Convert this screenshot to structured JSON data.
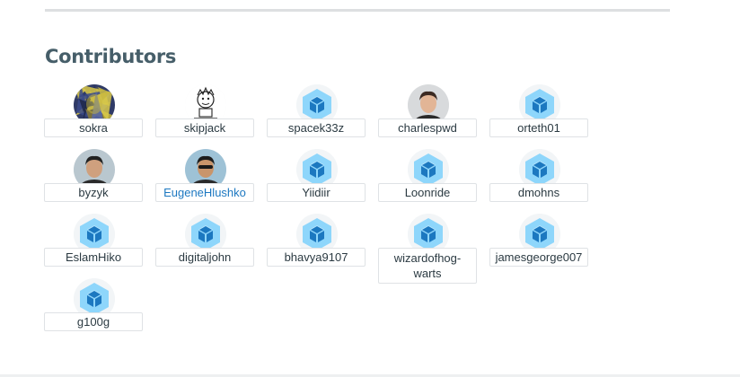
{
  "section": {
    "title": "Contributors"
  },
  "contributors": [
    {
      "name": "sokra",
      "avatar": "photo",
      "avatar_icon": "mosaic-portrait-avatar"
    },
    {
      "name": "skipjack",
      "avatar": "photo",
      "avatar_icon": "cartoon-character-avatar"
    },
    {
      "name": "spacek33z",
      "avatar": "default",
      "avatar_icon": "webpack-cube-icon"
    },
    {
      "name": "charlespwd",
      "avatar": "photo",
      "avatar_icon": "person-photo-avatar"
    },
    {
      "name": "orteth01",
      "avatar": "default",
      "avatar_icon": "webpack-cube-icon"
    },
    {
      "name": "byzyk",
      "avatar": "photo",
      "avatar_icon": "person-photo-avatar"
    },
    {
      "name": "EugeneHlushko",
      "avatar": "photo",
      "avatar_icon": "person-sunglasses-avatar",
      "highlighted": true
    },
    {
      "name": "Yiidiir",
      "avatar": "default",
      "avatar_icon": "webpack-cube-icon"
    },
    {
      "name": "Loonride",
      "avatar": "default",
      "avatar_icon": "webpack-cube-icon"
    },
    {
      "name": "dmohns",
      "avatar": "default",
      "avatar_icon": "webpack-cube-icon"
    },
    {
      "name": "EslamHiko",
      "avatar": "default",
      "avatar_icon": "webpack-cube-icon"
    },
    {
      "name": "digitaljohn",
      "avatar": "default",
      "avatar_icon": "webpack-cube-icon"
    },
    {
      "name": "bhavya9107",
      "avatar": "default",
      "avatar_icon": "webpack-cube-icon"
    },
    {
      "name": "wizardofhogwarts",
      "display_name": "wizardofhog-\nwarts",
      "avatar": "default",
      "avatar_icon": "webpack-cube-icon"
    },
    {
      "name": "jamesgeorge007",
      "avatar": "default",
      "avatar_icon": "webpack-cube-icon"
    },
    {
      "name": "g100g",
      "avatar": "default",
      "avatar_icon": "webpack-cube-icon"
    }
  ],
  "colors": {
    "heading": "#465e69",
    "text": "#2b3a42",
    "link": "#1d78c1",
    "cube_outer": "#8ed6fb",
    "cube_inner": "#1c78c0"
  }
}
